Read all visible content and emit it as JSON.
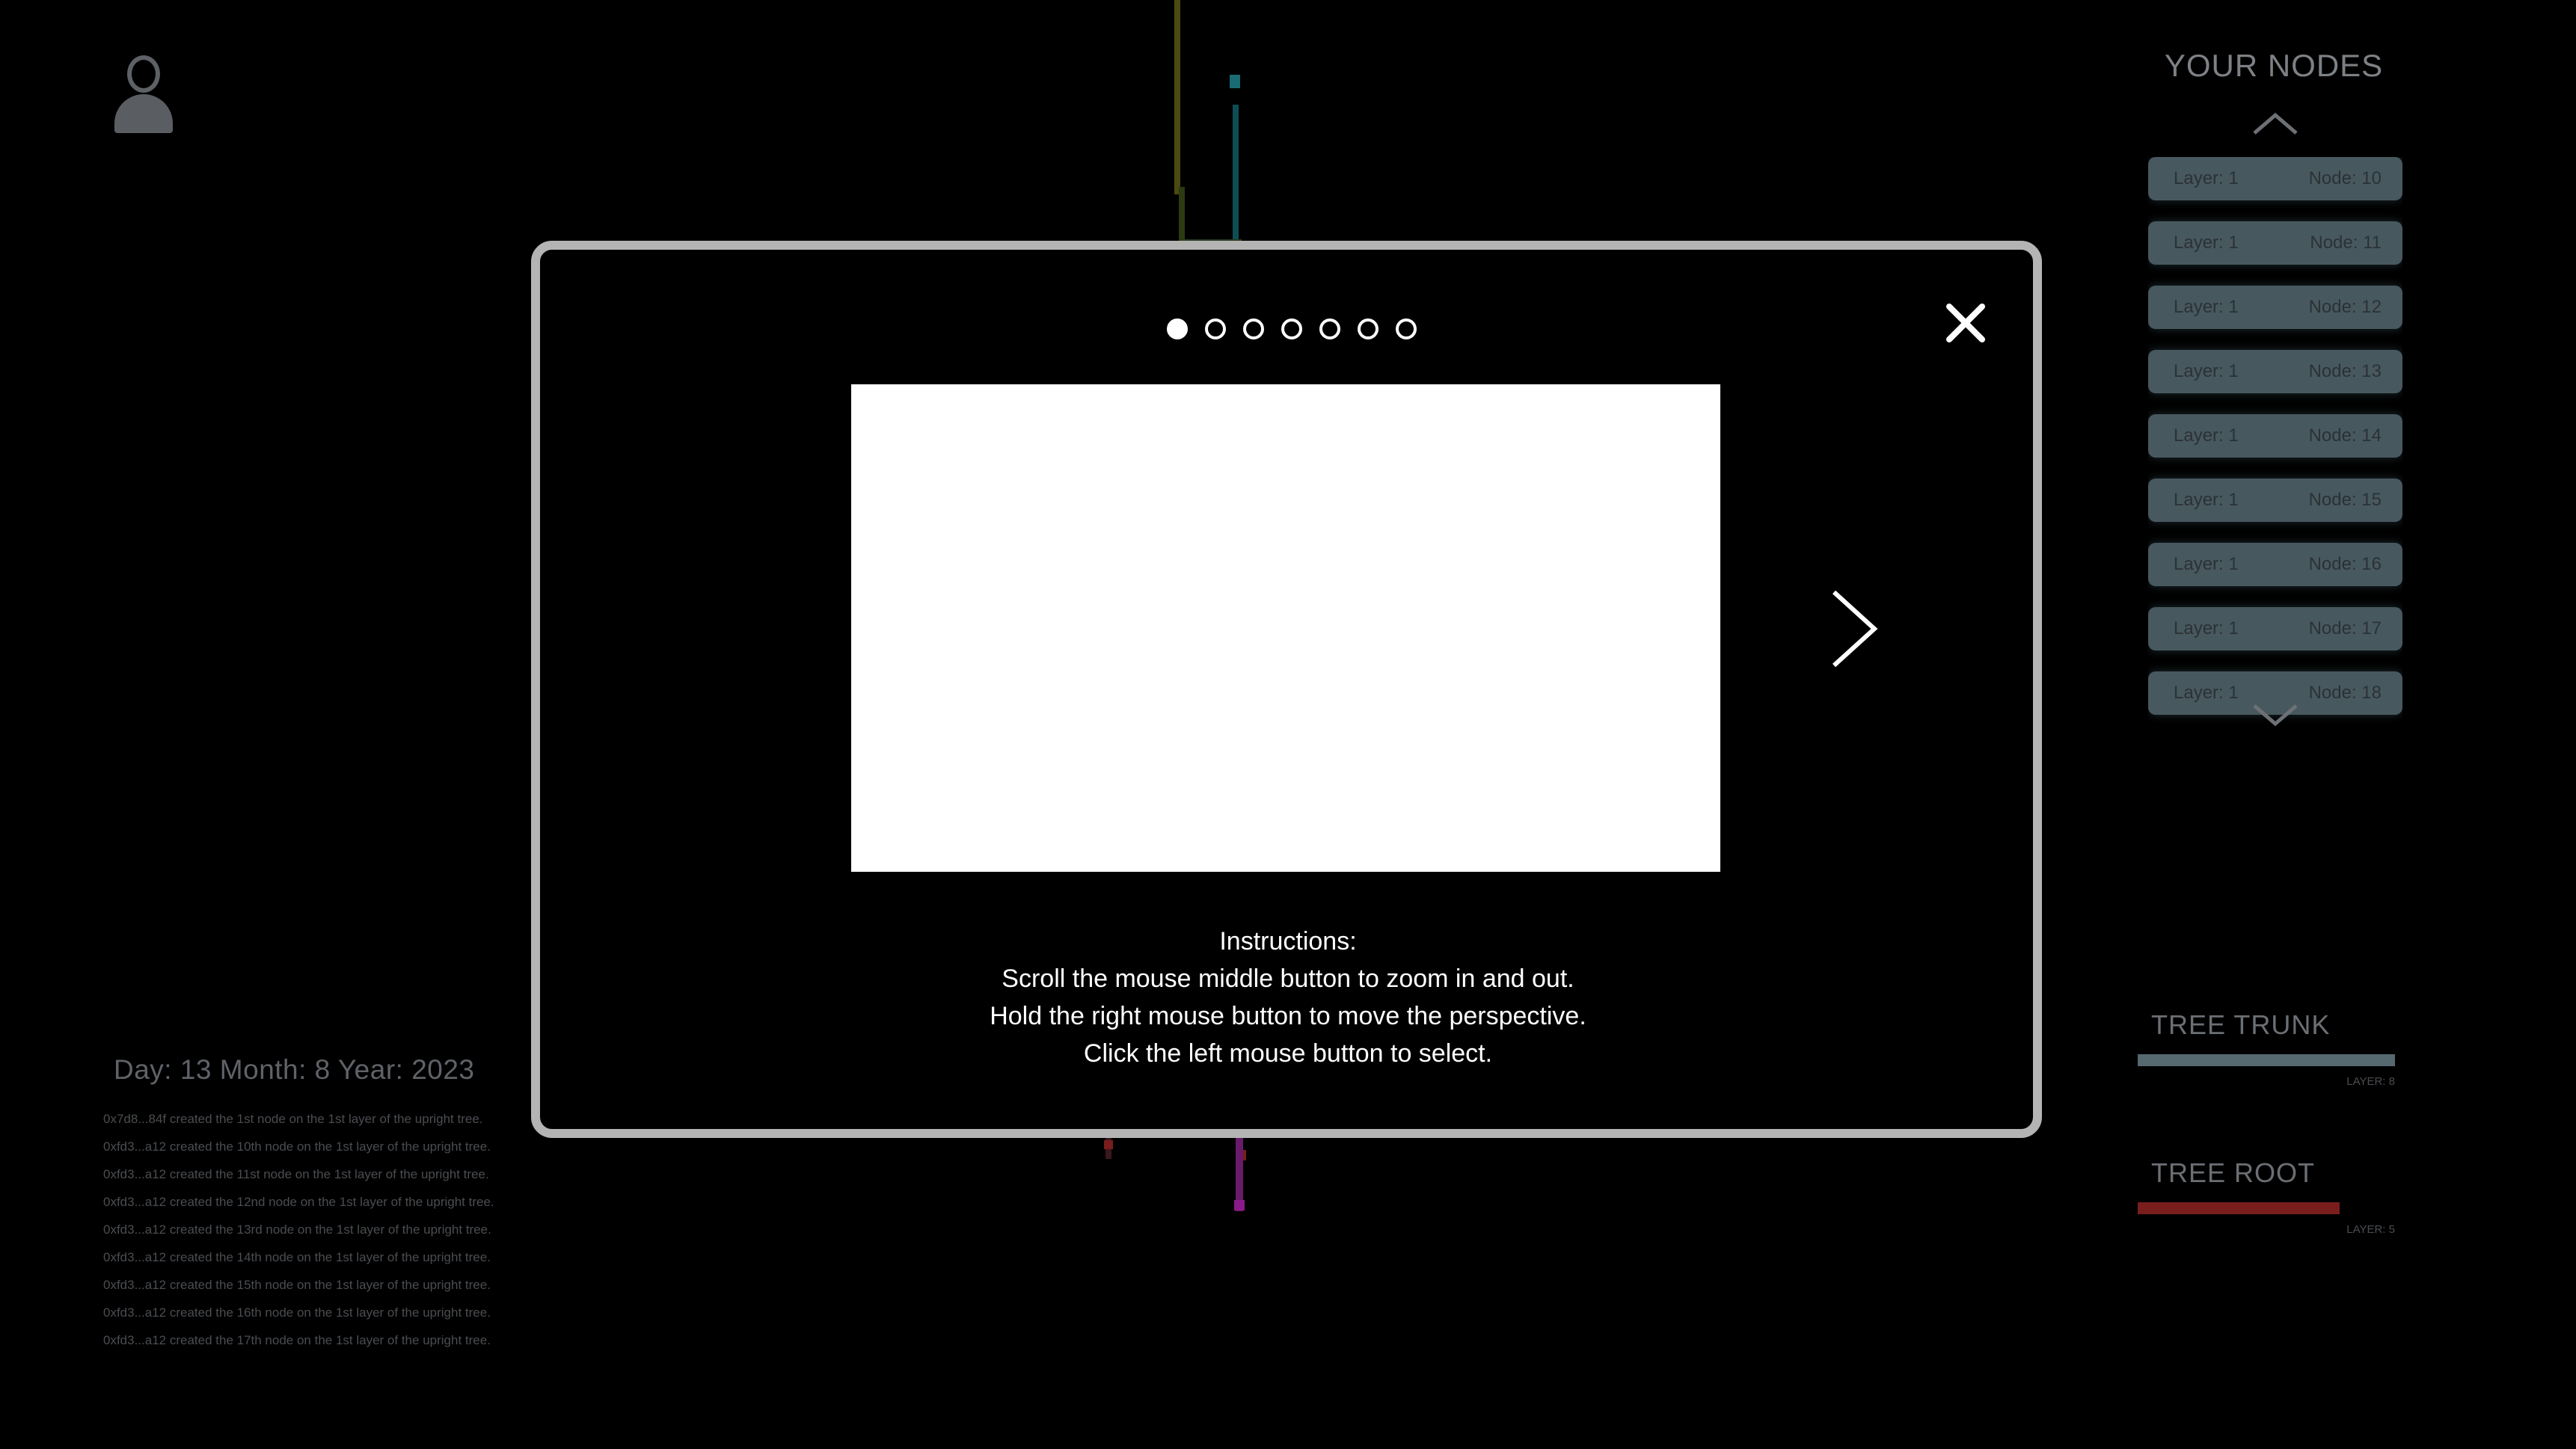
{
  "user": {
    "avatar_icon": "user-avatar-icon"
  },
  "date_line": "Day: 13  Month: 8  Year: 2023",
  "activity_log": [
    "0x7d8...84f created the 1st node on the 1st layer of the upright tree.",
    "0xfd3...a12 created the 10th node on the 1st layer of the upright tree.",
    "0xfd3...a12 created the 11st node on the 1st layer of the upright tree.",
    "0xfd3...a12 created the 12nd node on the 1st layer of the upright tree.",
    "0xfd3...a12 created the 13rd node on the 1st layer of the upright tree.",
    "0xfd3...a12 created the 14th node on the 1st layer of the upright tree.",
    "0xfd3...a12 created the 15th node on the 1st layer of the upright tree.",
    "0xfd3...a12 created the 16th node on the 1st layer of the upright tree.",
    "0xfd3...a12 created the 17th node on the 1st layer of the upright tree."
  ],
  "nodes_panel": {
    "title": "YOUR NODES",
    "items": [
      {
        "layer": "Layer: 1",
        "node": "Node: 10"
      },
      {
        "layer": "Layer: 1",
        "node": "Node: 11"
      },
      {
        "layer": "Layer: 1",
        "node": "Node: 12"
      },
      {
        "layer": "Layer: 1",
        "node": "Node: 13"
      },
      {
        "layer": "Layer: 1",
        "node": "Node: 14"
      },
      {
        "layer": "Layer: 1",
        "node": "Node: 15"
      },
      {
        "layer": "Layer: 1",
        "node": "Node: 16"
      },
      {
        "layer": "Layer: 1",
        "node": "Node: 17"
      },
      {
        "layer": "Layer: 1",
        "node": "Node: 18"
      }
    ]
  },
  "legend": {
    "trunk": {
      "title": "TREE TRUNK",
      "layer": "LAYER: 8",
      "color": "#566870"
    },
    "root": {
      "title": "TREE ROOT",
      "layer": "LAYER: 5",
      "color": "#7a1d1d"
    }
  },
  "modal": {
    "pages": 7,
    "current_page": 1,
    "instructions": [
      "Instructions:",
      "Scroll the mouse middle button to zoom in and out.",
      "Hold the right mouse button to move the perspective.",
      "Click the left mouse button to select."
    ],
    "close_icon": "close-icon",
    "next_icon": "chevron-right-icon"
  }
}
